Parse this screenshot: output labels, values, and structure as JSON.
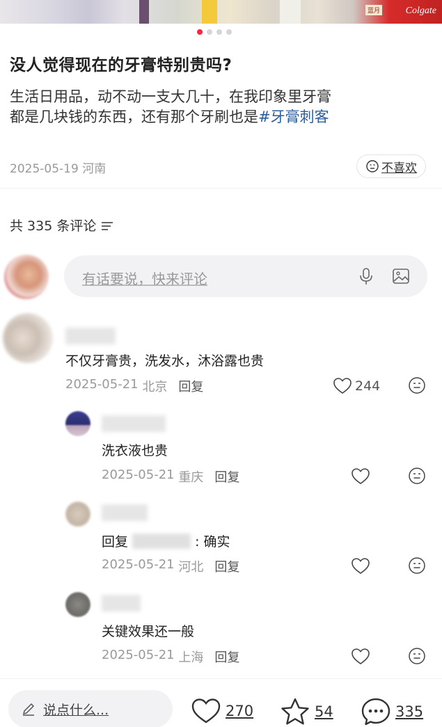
{
  "hero": {
    "brand": "Colgate",
    "brand2": "蓝月"
  },
  "pager": {
    "count": 4,
    "active": 0
  },
  "post": {
    "title": "没人觉得现在的牙膏特别贵吗?",
    "body_line1": "生活日用品，动不动一支大几十，在我印象里牙膏",
    "body_line2": "都是几块钱的东西，还有那个牙刷也是",
    "tag": "#牙膏刺客",
    "date": "2025-05-19",
    "location": "河南",
    "dislike_label": "不喜欢"
  },
  "comments_header": {
    "label": "共 335 条评论"
  },
  "comment_input": {
    "placeholder": "有话要说，快来评论"
  },
  "comments": [
    {
      "text": "不仅牙膏贵，洗发水，沐浴露也贵",
      "date": "2025-05-21",
      "location": "北京",
      "reply_label": "回复",
      "likes": "244"
    },
    {
      "text": "洗衣液也贵",
      "date": "2025-05-21",
      "location": "重庆",
      "reply_label": "回复"
    },
    {
      "text_prefix": "回复",
      "text_suffix": ": 确实",
      "date": "2025-05-21",
      "location": "河北",
      "reply_label": "回复"
    },
    {
      "text": "关键效果还一般",
      "date": "2025-05-21",
      "location": "上海",
      "reply_label": "回复"
    }
  ],
  "bottom_bar": {
    "say_placeholder": "说点什么...",
    "likes": "270",
    "stars": "54",
    "comments": "335"
  },
  "colors": {
    "accent": "#ff2442",
    "tag": "#2a5e9e",
    "muted": "#999999"
  }
}
